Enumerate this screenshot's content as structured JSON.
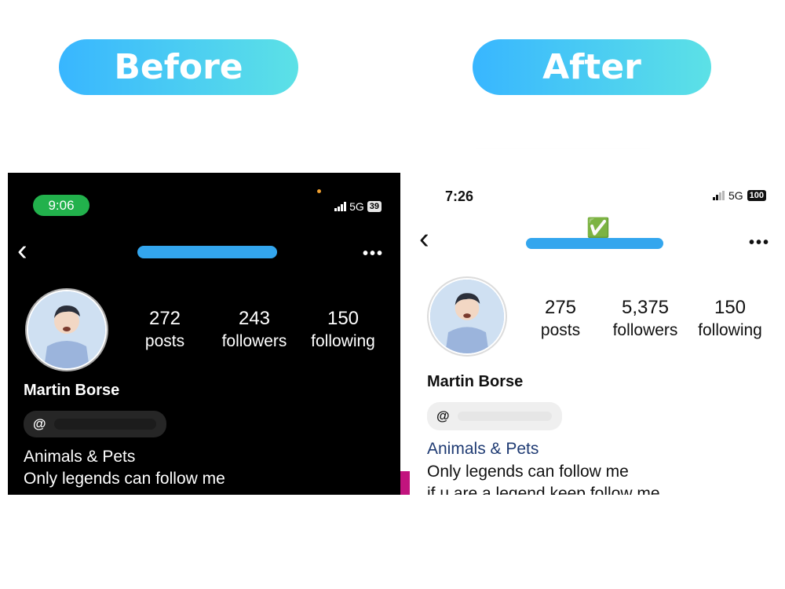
{
  "labels": {
    "before": "Before",
    "after": "After"
  },
  "before": {
    "time": "9:06",
    "network": "5G",
    "battery": "39",
    "back_icon": "chevron-left-icon",
    "more_icon": "more-dots-icon",
    "stats": [
      {
        "value": "272",
        "label": "posts"
      },
      {
        "value": "243",
        "label": "followers"
      },
      {
        "value": "150",
        "label": "following"
      }
    ],
    "name": "Martin Borse",
    "threads_icon": "threads-icon",
    "category": "Animals & Pets",
    "bio_line1": "Only legends can follow me"
  },
  "after": {
    "time": "7:26",
    "network": "5G",
    "battery": "100",
    "verified_badge": "✅",
    "back_icon": "chevron-left-icon",
    "more_icon": "more-dots-icon",
    "stats": [
      {
        "value": "275",
        "label": "posts"
      },
      {
        "value": "5,375",
        "label": "followers"
      },
      {
        "value": "150",
        "label": "following"
      }
    ],
    "name": "Martin Borse",
    "threads_icon": "threads-icon",
    "category": "Animals & Pets",
    "bio_line1": "Only legends can follow me",
    "bio_line2": "if u are a legend keep follow me"
  },
  "colors": {
    "pill_gradient_start": "#38b6ff",
    "pill_gradient_end": "#5ce1e6",
    "redaction_blue": "#33a6ee",
    "time_pill_green": "#22b14c",
    "category_link": "#1f3b73"
  }
}
